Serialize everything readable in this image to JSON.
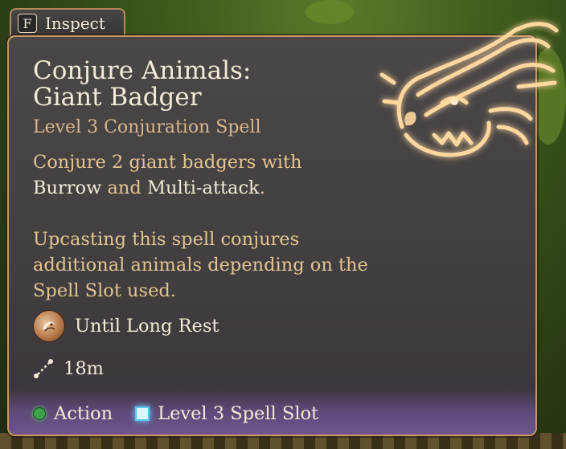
{
  "inspect": {
    "key": "F",
    "label": "Inspect"
  },
  "spell": {
    "title_line1": "Conjure Animals:",
    "title_line2": "Giant Badger",
    "subtitle": "Level 3 Conjuration Spell",
    "description": {
      "part1": "Conjure 2 giant badgers with",
      "keyword1": "Burrow",
      "connector": " and ",
      "keyword2": "Multi-attack",
      "end": "."
    },
    "upcast": "Upcasting this spell conjures additional animals depending on the Spell Slot used.",
    "duration": "Until Long Rest",
    "range": "18m",
    "costs": {
      "action": "Action",
      "slot": "Level 3 Spell Slot"
    }
  },
  "colors": {
    "accent_gold": "#c99662",
    "text_light": "#f3ead8",
    "text_gold": "#e2c592",
    "action_green": "#3fa04a",
    "slot_cyan": "#5ac8f0",
    "footer_purple": "#6e5590"
  },
  "icons": {
    "spell_icon": "badger-head-icon",
    "duration_icon": "long-rest-icon",
    "range_icon": "range-icon",
    "action_icon": "action-dot-icon",
    "slot_icon": "spell-slot-icon"
  }
}
